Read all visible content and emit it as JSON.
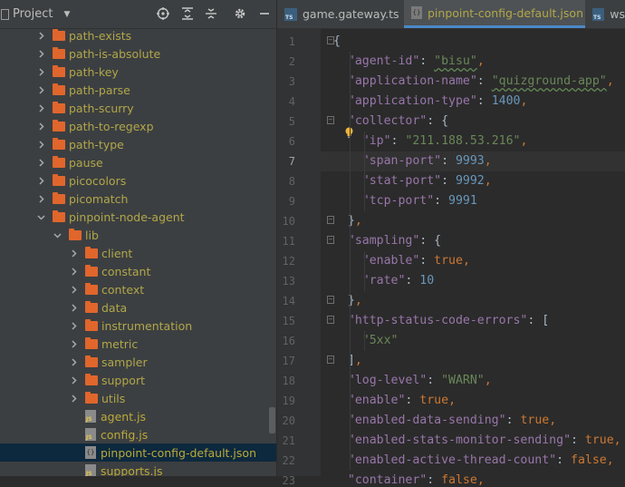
{
  "project": {
    "title": "Project",
    "tree": [
      {
        "label": "path-exists",
        "depth": 0,
        "type": "folder",
        "expanded": false
      },
      {
        "label": "path-is-absolute",
        "depth": 0,
        "type": "folder",
        "expanded": false
      },
      {
        "label": "path-key",
        "depth": 0,
        "type": "folder",
        "expanded": false
      },
      {
        "label": "path-parse",
        "depth": 0,
        "type": "folder",
        "expanded": false
      },
      {
        "label": "path-scurry",
        "depth": 0,
        "type": "folder",
        "expanded": false
      },
      {
        "label": "path-to-regexp",
        "depth": 0,
        "type": "folder",
        "expanded": false
      },
      {
        "label": "path-type",
        "depth": 0,
        "type": "folder",
        "expanded": false
      },
      {
        "label": "pause",
        "depth": 0,
        "type": "folder",
        "expanded": false
      },
      {
        "label": "picocolors",
        "depth": 0,
        "type": "folder",
        "expanded": false
      },
      {
        "label": "picomatch",
        "depth": 0,
        "type": "folder",
        "expanded": false
      },
      {
        "label": "pinpoint-node-agent",
        "depth": 0,
        "type": "folder",
        "expanded": true
      },
      {
        "label": "lib",
        "depth": 1,
        "type": "folder",
        "expanded": true
      },
      {
        "label": "client",
        "depth": 2,
        "type": "folder",
        "expanded": false
      },
      {
        "label": "constant",
        "depth": 2,
        "type": "folder",
        "expanded": false
      },
      {
        "label": "context",
        "depth": 2,
        "type": "folder",
        "expanded": false
      },
      {
        "label": "data",
        "depth": 2,
        "type": "folder",
        "expanded": false
      },
      {
        "label": "instrumentation",
        "depth": 2,
        "type": "folder",
        "expanded": false
      },
      {
        "label": "metric",
        "depth": 2,
        "type": "folder",
        "expanded": false
      },
      {
        "label": "sampler",
        "depth": 2,
        "type": "folder",
        "expanded": false
      },
      {
        "label": "support",
        "depth": 2,
        "type": "folder",
        "expanded": false
      },
      {
        "label": "utils",
        "depth": 2,
        "type": "folder",
        "expanded": false
      },
      {
        "label": "agent.js",
        "depth": 2,
        "type": "js"
      },
      {
        "label": "config.js",
        "depth": 2,
        "type": "js"
      },
      {
        "label": "pinpoint-config-default.json",
        "depth": 2,
        "type": "json",
        "selected": true
      },
      {
        "label": "supports.js",
        "depth": 2,
        "type": "js"
      }
    ]
  },
  "tabs": [
    {
      "label": "game.gateway.ts",
      "icon": "ts",
      "active": false
    },
    {
      "label": "pinpoint-config-default.json",
      "icon": "json",
      "active": true
    },
    {
      "label": "ws",
      "icon": "ts",
      "active": false
    }
  ],
  "editor": {
    "current_line": 7,
    "lines": [
      [
        [
          "br",
          "{"
        ]
      ],
      [
        [
          "k",
          "  \"agent-id\""
        ],
        [
          "br",
          ": "
        ],
        [
          "s",
          "\"bisu\"",
          true
        ],
        [
          "p",
          ","
        ]
      ],
      [
        [
          "k",
          "  \"application-name\""
        ],
        [
          "br",
          ": "
        ],
        [
          "s",
          "\"quizground-app\"",
          true
        ],
        [
          "p",
          ","
        ]
      ],
      [
        [
          "k",
          "  \"application-type\""
        ],
        [
          "br",
          ": "
        ],
        [
          "n",
          "1400"
        ],
        [
          "p",
          ","
        ]
      ],
      [
        [
          "k",
          "  \"collector\""
        ],
        [
          "br",
          ": {"
        ]
      ],
      [
        [
          "k",
          "    \"ip\""
        ],
        [
          "br",
          ": "
        ],
        [
          "s",
          "\"211.188.53.216\""
        ],
        [
          "p",
          ","
        ]
      ],
      [
        [
          "k",
          "    \"span-port\""
        ],
        [
          "br",
          ": "
        ],
        [
          "n",
          "9993"
        ],
        [
          "p",
          ","
        ]
      ],
      [
        [
          "k",
          "    \"stat-port\""
        ],
        [
          "br",
          ": "
        ],
        [
          "n",
          "9992"
        ],
        [
          "p",
          ","
        ]
      ],
      [
        [
          "k",
          "    \"tcp-port\""
        ],
        [
          "br",
          ": "
        ],
        [
          "n",
          "9991"
        ]
      ],
      [
        [
          "br",
          "  }"
        ],
        [
          "p",
          ","
        ]
      ],
      [
        [
          "k",
          "  \"sampling\""
        ],
        [
          "br",
          ": {"
        ]
      ],
      [
        [
          "k",
          "    \"enable\""
        ],
        [
          "br",
          ": "
        ],
        [
          "b",
          "true"
        ],
        [
          "p",
          ","
        ]
      ],
      [
        [
          "k",
          "    \"rate\""
        ],
        [
          "br",
          ": "
        ],
        [
          "n",
          "10"
        ]
      ],
      [
        [
          "br",
          "  }"
        ],
        [
          "p",
          ","
        ]
      ],
      [
        [
          "k",
          "  \"http-status-code-errors\""
        ],
        [
          "br",
          ": ["
        ]
      ],
      [
        [
          "s",
          "    \"5xx\""
        ]
      ],
      [
        [
          "br",
          "  ]"
        ],
        [
          "p",
          ","
        ]
      ],
      [
        [
          "k",
          "  \"log-level\""
        ],
        [
          "br",
          ": "
        ],
        [
          "s",
          "\"WARN\""
        ],
        [
          "p",
          ","
        ]
      ],
      [
        [
          "k",
          "  \"enable\""
        ],
        [
          "br",
          ": "
        ],
        [
          "b",
          "true"
        ],
        [
          "p",
          ","
        ]
      ],
      [
        [
          "k",
          "  \"enabled-data-sending\""
        ],
        [
          "br",
          ": "
        ],
        [
          "b",
          "true"
        ],
        [
          "p",
          ","
        ]
      ],
      [
        [
          "k",
          "  \"enabled-stats-monitor-sending\""
        ],
        [
          "br",
          ": "
        ],
        [
          "b",
          "true"
        ],
        [
          "p",
          ","
        ]
      ],
      [
        [
          "k",
          "  \"enabled-active-thread-count\""
        ],
        [
          "br",
          ": "
        ],
        [
          "b",
          "false"
        ],
        [
          "p",
          ","
        ]
      ],
      [
        [
          "k",
          "  \"container\""
        ],
        [
          "br",
          ": "
        ],
        [
          "b",
          "false"
        ],
        [
          "p",
          ","
        ]
      ]
    ]
  },
  "colors": {
    "background": "#2b2b2b",
    "panel": "#3c3f41",
    "selection": "#0d293e",
    "folder": "#e0662c",
    "key": "#9876aa",
    "string": "#6a8759",
    "number": "#6897bb",
    "keyword": "#cc7832",
    "tab_accent": "#4a88c7"
  }
}
